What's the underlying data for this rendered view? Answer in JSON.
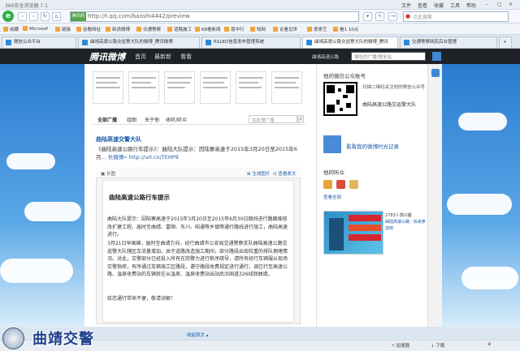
{
  "window": {
    "title": "360安全浏览器 7.1",
    "menu": [
      "文件",
      "查看",
      "收藏",
      "工具",
      "帮助"
    ]
  },
  "address": {
    "tag": "腾讯网",
    "url": "http://t.qq.com/baoshi4442/preview"
  },
  "search": {
    "placeholder": "点此搜索"
  },
  "favorites": [
    "收藏",
    "Microsof",
    "链接",
    "谷歌网址",
    "新浪微博",
    "交通警察",
    "道路施工",
    "68看新闻",
    "南中行",
    "知网",
    "论看见世",
    "爱奇艺",
    "看1 10点"
  ],
  "tabs": [
    {
      "label": "微信公众平台",
      "active": false
    },
    {
      "label": "曲靖高速公路交巡警大队的微博_腾讯微博",
      "active": false
    },
    {
      "label": "RSLED信息发布管理系统",
      "active": false
    },
    {
      "label": "曲靖高速公路交巡警大队的微博_腾讯",
      "active": true
    },
    {
      "label": "交通警察网民后台管理",
      "active": false
    }
  ],
  "site": {
    "logo": "腾讯微博",
    "nav": [
      "首页",
      "最新新",
      "看看"
    ],
    "user": "曲靖高速公路",
    "search_placeholder": "搜包的广播/搜全站"
  },
  "feed_tabs": [
    "全部广播",
    "组图",
    "关于他",
    "收听/听众"
  ],
  "feed_search_placeholder": "在此搜广播",
  "post": {
    "author": "曲陆高速交警大队",
    "text": "《曲陆高速公路行车提示》：曲陆大队提示：因陆寨高速于2015年3月20日至2015年6月...",
    "link": "长微博» http://url.cn/TEHP9"
  },
  "card": {
    "label": "长图",
    "actions": [
      "生成图片",
      "查看原文"
    ],
    "collapse": "收起原文"
  },
  "doc": {
    "title": "曲陆高速公路行车提示",
    "paras": [
      "曲陆大队提示：因陆寨高速于2015年3月20日至2015年6月30日期间进行路面维修改扩建工程，届时至曲靖、富顺、东川、昭通等乡镇等通行路线进行施工，曲陆高速进行。",
      "3月21日早高峰，届时至曲靖方向，经行曲靖市公安局交通警察支队曲陆高速公路交巡警大队辖区车流量增加，由于道路改造施工期间，部分路段出现较重的排队拥堵情况。对此，交警部分已经投入所有在岗警力进行秩序疏导，请所有经行车辆服从现场交警指挥，有序通过车辆施工区路段，遵守路段收费规定进行通行。调已行至高速公路、温泉收费站的车辆就在从温泉、温泉收费站出站后沿国道326线回曲靖。",
      "给您通行带来不便，敬请谅解！"
    ]
  },
  "sidebar": {
    "title": "他的微信公众账号",
    "qr_text": "扫描二维码关注他的微信公众号",
    "qr_name": "曲陆高速公路交巡警大队",
    "timeline_link": "看看我的微博时光记录",
    "fans_title": "他的听众",
    "fans_all": "查看全部",
    "banner_text": "2783人感兴趣",
    "banner_link": "曲陆高速公路 · 快来参加吧"
  },
  "status": [
    "加速器",
    "下载"
  ],
  "watermark": "曲靖交警",
  "colors": {
    "site_nav": "#1f2328",
    "sky": "#2b7bd0",
    "link": "#1a5ba8"
  }
}
